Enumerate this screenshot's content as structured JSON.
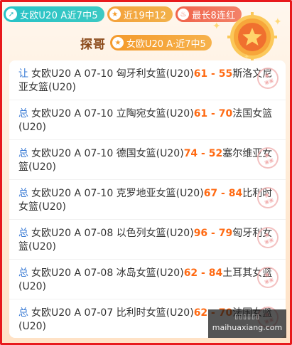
{
  "tags": [
    {
      "icon": "up-arrow-icon",
      "label": "女欧U20 A近7中5"
    },
    {
      "icon": "star-icon",
      "label": "近19中12"
    },
    {
      "icon": "flame-icon",
      "label": "最长8连红"
    }
  ],
  "header": {
    "name": "探哥",
    "pill_label": "女欧U20 A·近7中5"
  },
  "rows": [
    {
      "kind": "让",
      "league": "女欧U20 A",
      "date": "07-10",
      "home": "匈牙利女篮(U20)",
      "score": "61 - 55",
      "away": "斯洛文尼亚女篮(U20)",
      "stamp": true
    },
    {
      "kind": "总",
      "league": "女欧U20 A",
      "date": "07-10",
      "home": "立陶宛女篮(U20)",
      "score": "61 - 70",
      "away": "法国女篮(U20)",
      "stamp": false
    },
    {
      "kind": "总",
      "league": "女欧U20 A",
      "date": "07-10",
      "home": "德国女篮(U20)",
      "score": "74 - 52",
      "away": "塞尔维亚女篮(U20)",
      "stamp": true
    },
    {
      "kind": "总",
      "league": "女欧U20 A",
      "date": "07-10",
      "home": "克罗地亚女篮(U20)",
      "score": "67 - 84",
      "away": "比利时女篮(U20)",
      "stamp": true
    },
    {
      "kind": "总",
      "league": "女欧U20 A",
      "date": "07-08",
      "home": "以色列女篮(U20)",
      "score": "96 - 79",
      "away": "匈牙利女篮(U20)",
      "stamp": true
    },
    {
      "kind": "总",
      "league": "女欧U20 A",
      "date": "07-08",
      "home": "冰岛女篮(U20)",
      "score": "62 - 84",
      "away": "土耳其女篮(U20)",
      "stamp": true
    },
    {
      "kind": "总",
      "league": "女欧U20 A",
      "date": "07-07",
      "home": "比利时女篮(U20)",
      "score": "62 - 70",
      "away": "法国女篮(U20)",
      "stamp": true
    }
  ],
  "watermark": {
    "logo": "▯▯▯▯▯▯",
    "url": "maihuaxiang.com"
  },
  "colors": {
    "frame": "#e8191c",
    "score": "#ff6a13",
    "kind": "#3a7bd5"
  }
}
